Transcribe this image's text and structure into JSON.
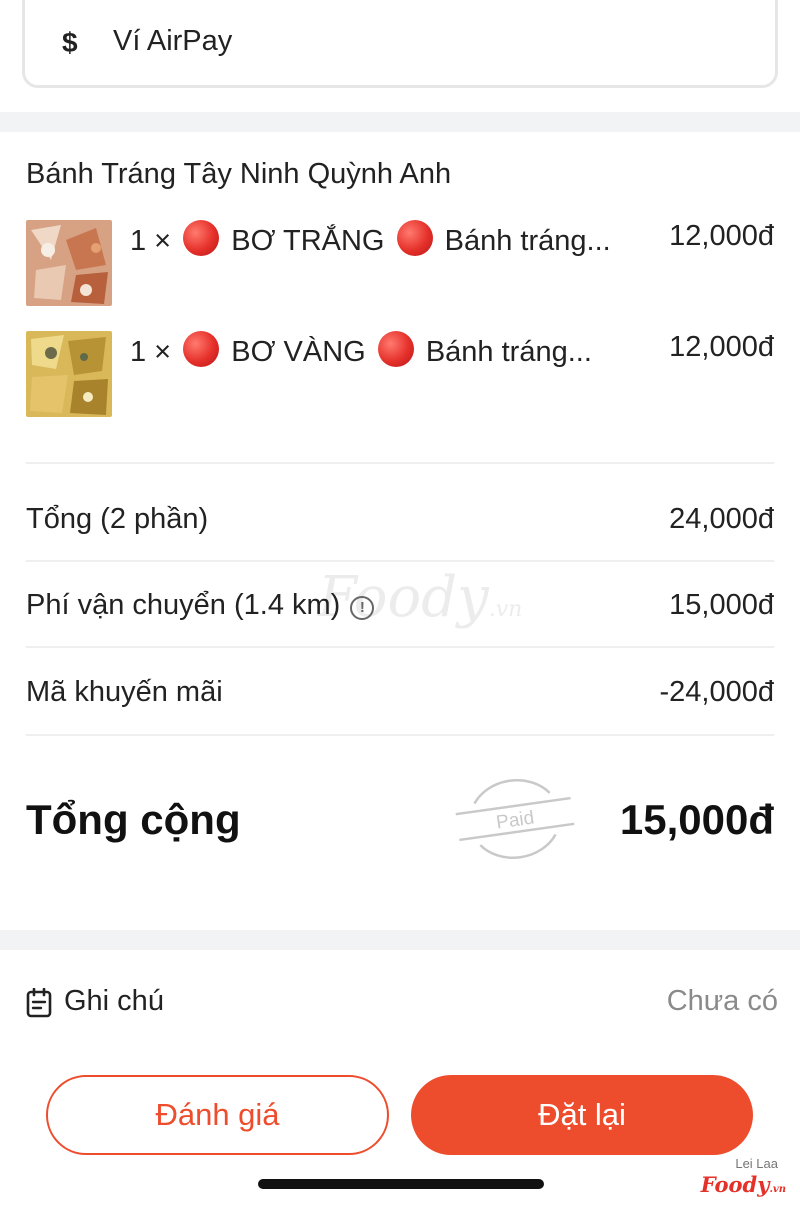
{
  "payment": {
    "icon": "dollar-icon",
    "icon_glyph": "$",
    "method": "Ví AirPay"
  },
  "restaurant": {
    "name": "Bánh Tráng Tây Ninh Quỳnh Anh"
  },
  "items": [
    {
      "qty": "1 ×",
      "name_a": "BƠ TRẮNG",
      "name_b": "Bánh tráng...",
      "price": "12,000đ"
    },
    {
      "qty": "1 ×",
      "name_a": "BƠ VÀNG",
      "name_b": "Bánh tráng...",
      "price": "12,000đ"
    }
  ],
  "summary": {
    "subtotal_label": "Tổng (2 phần)",
    "subtotal_value": "24,000đ",
    "shipping_label": "Phí vận chuyển (1.4 km)",
    "shipping_value": "15,000đ",
    "promo_label": "Mã khuyến mãi",
    "promo_value": "-24,000đ",
    "total_label": "Tổng cộng",
    "total_value": "15,000đ",
    "paid_stamp": "Paid"
  },
  "note": {
    "label": "Ghi chú",
    "value": "Chưa có"
  },
  "actions": {
    "rate_label": "Đánh giá",
    "reorder_label": "Đặt lại"
  },
  "watermark": {
    "brand": "Foody",
    "tld": ".vn"
  },
  "credit": {
    "user": "Lei Laa",
    "brand": "Foody",
    "tld": ".vn"
  },
  "colors": {
    "accent": "#ee4d2d",
    "band": "#f2f3f5",
    "muted": "#8a8a8a"
  }
}
